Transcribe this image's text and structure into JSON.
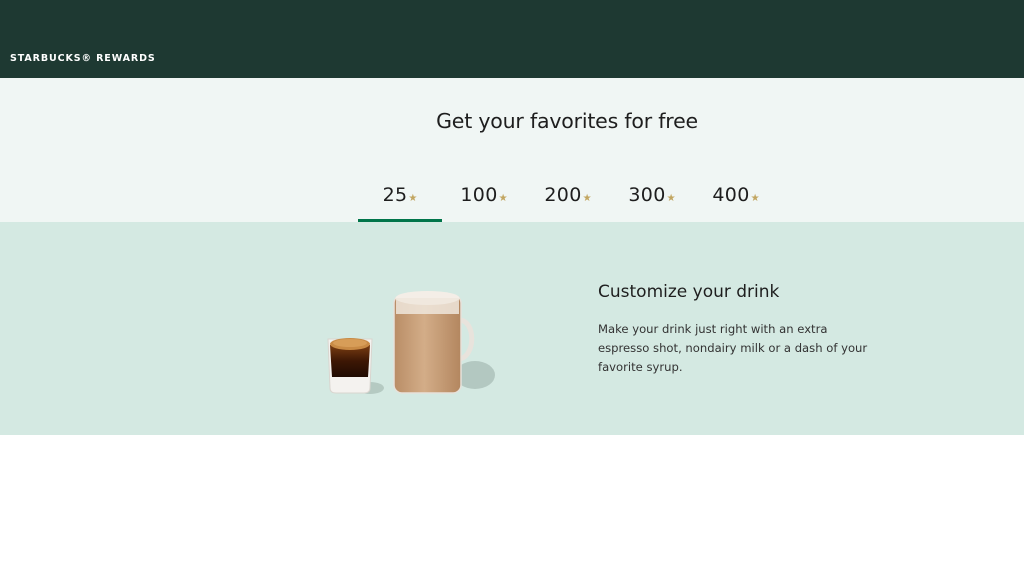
{
  "header": {
    "brand": "STARBUCKS® REWARDS"
  },
  "rewards": {
    "headline": "Get your favorites for free",
    "tabs": [
      {
        "label": "25",
        "active": true
      },
      {
        "label": "100",
        "active": false
      },
      {
        "label": "200",
        "active": false
      },
      {
        "label": "300",
        "active": false
      },
      {
        "label": "400",
        "active": false
      }
    ],
    "star_glyph": "★"
  },
  "feature": {
    "title": "Customize your drink",
    "description": "Make your drink just right with an extra espresso shot, nondairy milk or a dash of your favorite syrup.",
    "image_icon": "espresso-and-latte-illustration"
  },
  "colors": {
    "header_bg": "#1e3932",
    "tabs_bg": "#f0f6f4",
    "content_bg": "#d4e9e2",
    "accent_green": "#00754a",
    "star_gold": "#c2a661"
  }
}
